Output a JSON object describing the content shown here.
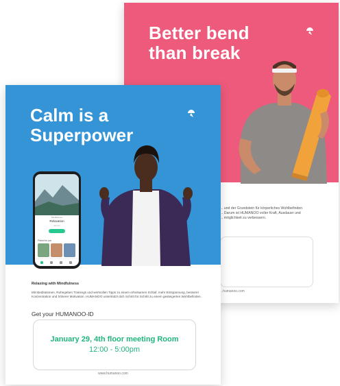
{
  "back_flyer": {
    "title_line1": "Better bend",
    "title_line2": "than break",
    "text_line1": "... und der Grundstein für körperliches Wohlbefinden",
    "text_line2": "... Darum ist HUMANOO voller Kraft, Ausdauer und",
    "text_line3": "... möglichkeit zu verbessern.",
    "url": "...humanoo.com"
  },
  "front_flyer": {
    "title_line1": "Calm is a",
    "title_line2": "Superpower",
    "phone": {
      "category": "Mindfulness",
      "session_name": "Relaxation",
      "session_sub": "10 min",
      "section_label": "Picked for you"
    },
    "heading": "Relaxing with Mindfulness",
    "body": "Mit Meditationen, Ruhegeben Trainings und wertvollen Tipps zu einem erholsamen Schlaf, mehr Entspannung, besserer Konzentration und höherer Motivation. HUMANOO unterstützt dich Schritt für Schritt zu einem gesteigerten Wohlbefinden.",
    "get_id_label": "Get your HUMANOO-ID",
    "event_line1": "January 29, 4th floor meeting Room",
    "event_line2": "12:00 - 5:00pm",
    "url": "www.humanoo.com"
  },
  "colors": {
    "pink": "#ee5a7c",
    "blue": "#3594d6",
    "green": "#20b57c"
  }
}
